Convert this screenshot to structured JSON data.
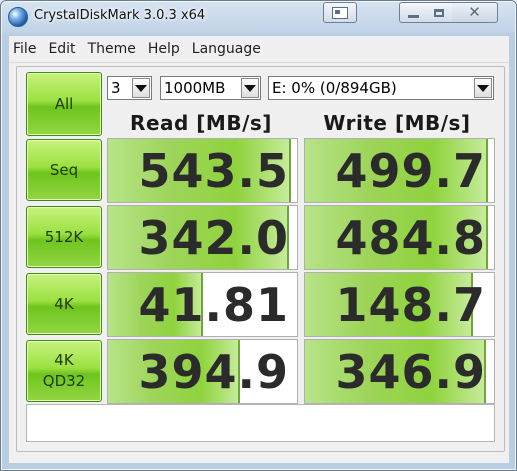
{
  "window": {
    "title": "CrystalDiskMark 3.0.3 x64"
  },
  "menu": [
    "File",
    "Edit",
    "Theme",
    "Help",
    "Language"
  ],
  "controls": {
    "all_label": "All",
    "count_value": "3",
    "size_value": "1000MB",
    "drive_value": "E: 0% (0/894GB)"
  },
  "headers": {
    "read": "Read [MB/s]",
    "write": "Write [MB/s]"
  },
  "rows": [
    {
      "label": "Seq",
      "read": "543.5",
      "write": "499.7",
      "read_fill": 0.97,
      "write_fill": 0.97
    },
    {
      "label": "512K",
      "read": "342.0",
      "write": "484.8",
      "read_fill": 0.96,
      "write_fill": 0.97
    },
    {
      "label": "4K",
      "read": "41.81",
      "write": "148.7",
      "read_fill": 0.5,
      "write_fill": 0.89
    },
    {
      "label": "4K\nQD32",
      "read": "394.9",
      "write": "346.9",
      "read_fill": 0.7,
      "write_fill": 0.96
    }
  ],
  "comment": "",
  "colors": {
    "button_green": "#9be040",
    "bar_green": "#8fd33d",
    "frame": "#b9cde3"
  },
  "icons": {
    "app": "crystaldiskmark-icon",
    "extra": "snap-icon",
    "minimize": "minimize-icon",
    "maximize": "maximize-icon",
    "close": "close-icon"
  }
}
